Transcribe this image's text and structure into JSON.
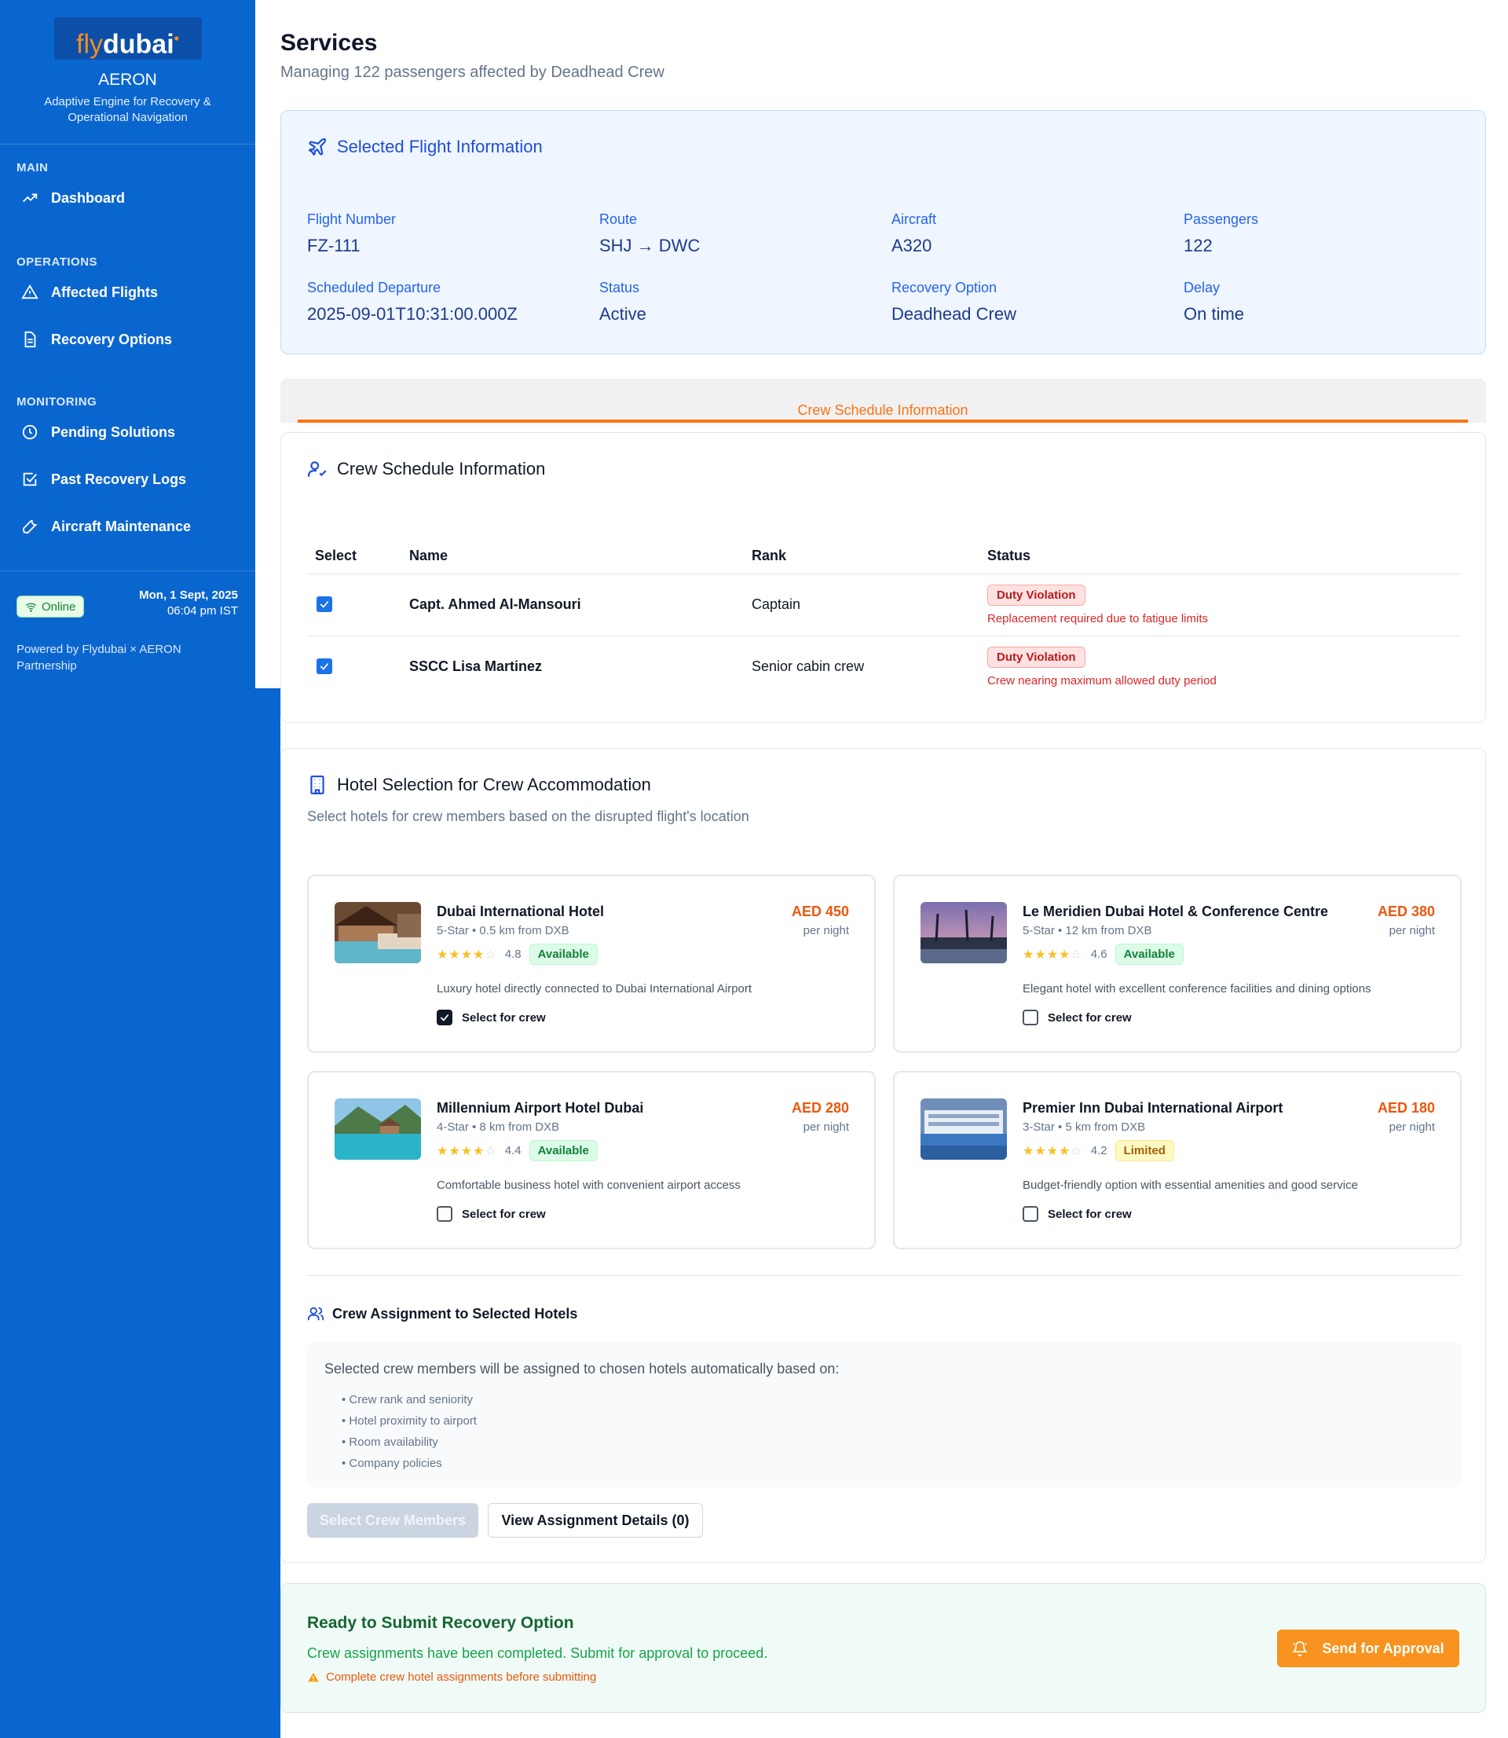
{
  "sidebar": {
    "logo_fly": "fly",
    "logo_dubai": "dubai",
    "app_name": "AERON",
    "app_tagline": "Adaptive Engine for Recovery & Operational Navigation",
    "sections": [
      {
        "title": "MAIN",
        "items": [
          {
            "label": "Dashboard",
            "icon": "trending-up-icon"
          }
        ]
      },
      {
        "title": "OPERATIONS",
        "items": [
          {
            "label": "Affected Flights",
            "icon": "alert-triangle-icon"
          },
          {
            "label": "Recovery Options",
            "icon": "document-icon"
          }
        ]
      },
      {
        "title": "MONITORING",
        "items": [
          {
            "label": "Pending Solutions",
            "icon": "clock-icon"
          },
          {
            "label": "Past Recovery Logs",
            "icon": "check-square-icon"
          },
          {
            "label": "Aircraft Maintenance",
            "icon": "wrench-icon"
          }
        ]
      }
    ],
    "online_label": "Online",
    "date": "Mon, 1 Sept, 2025",
    "time": "06:04 pm IST",
    "powered_by": "Powered by Flydubai × AERON Partnership"
  },
  "header": {
    "title": "Services",
    "subtitle": "Managing 122 passengers affected by Deadhead Crew"
  },
  "flight_info": {
    "title": "Selected Flight Information",
    "fields": [
      {
        "label": "Flight Number",
        "value": "FZ-111"
      },
      {
        "label": "Route",
        "value": "SHJ → DWC"
      },
      {
        "label": "Aircraft",
        "value": "A320"
      },
      {
        "label": "Passengers",
        "value": "122"
      },
      {
        "label": "Scheduled Departure",
        "value": "2025-09-01T10:31:00.000Z"
      },
      {
        "label": "Status",
        "value": "Active"
      },
      {
        "label": "Recovery Option",
        "value": "Deadhead Crew"
      },
      {
        "label": "Delay",
        "value": "On time"
      }
    ]
  },
  "tabs": {
    "active": "Crew Schedule Information"
  },
  "crew": {
    "title": "Crew Schedule Information",
    "columns": [
      "Select",
      "Name",
      "Rank",
      "Status"
    ],
    "rows": [
      {
        "selected": true,
        "name": "Capt. Ahmed Al-Mansouri",
        "rank": "Captain",
        "status": "Duty Violation",
        "note": "Replacement required due to fatigue limits"
      },
      {
        "selected": true,
        "name": "SSCC Lisa Martinez",
        "rank": "Senior cabin crew",
        "status": "Duty Violation",
        "note": "Crew nearing maximum allowed duty period"
      }
    ]
  },
  "hotels": {
    "title": "Hotel Selection for Crew Accommodation",
    "subtitle": "Select hotels for crew members based on the disrupted flight's location",
    "select_label": "Select for crew",
    "items": [
      {
        "name": "Dubai International Hotel",
        "meta": "5-Star • 0.5 km from DXB",
        "stars": "★★★★",
        "empty": "☆",
        "rating": "4.8",
        "availability": "Available",
        "description": "Luxury hotel directly connected to Dubai International Airport",
        "price": "AED 450",
        "per": "per night",
        "selected": true
      },
      {
        "name": "Le Meridien Dubai Hotel & Conference Centre",
        "meta": "5-Star • 12 km from DXB",
        "stars": "★★★★",
        "empty": "☆",
        "rating": "4.6",
        "availability": "Available",
        "description": "Elegant hotel with excellent conference facilities and dining options",
        "price": "AED 380",
        "per": "per night",
        "selected": false
      },
      {
        "name": "Millennium Airport Hotel Dubai",
        "meta": "4-Star • 8 km from DXB",
        "stars": "★★★★",
        "empty": "☆",
        "rating": "4.4",
        "availability": "Available",
        "description": "Comfortable business hotel with convenient airport access",
        "price": "AED 280",
        "per": "per night",
        "selected": false
      },
      {
        "name": "Premier Inn Dubai International Airport",
        "meta": "3-Star • 5 km from DXB",
        "stars": "★★★★",
        "empty": "☆",
        "rating": "4.2",
        "availability": "Limited",
        "description": "Budget-friendly option with essential amenities and good service",
        "price": "AED 180",
        "per": "per night",
        "selected": false
      }
    ]
  },
  "assignment": {
    "title": "Crew Assignment to Selected Hotels",
    "intro": "Selected crew members will be assigned to chosen hotels automatically based on:",
    "criteria": [
      "Crew rank and seniority",
      "Hotel proximity to airport",
      "Room availability",
      "Company policies"
    ],
    "select_button": "Select Crew Members",
    "details_button": "View Assignment Details (0)"
  },
  "submit": {
    "title": "Ready to Submit Recovery Option",
    "text": "Crew assignments have been completed. Submit for approval to proceed.",
    "warning": "Complete crew hotel assignments before submitting",
    "button": "Send for Approval"
  },
  "colors": {
    "sidebar": "#0a66cf",
    "accent": "#f97316",
    "primary": "#2563eb"
  }
}
